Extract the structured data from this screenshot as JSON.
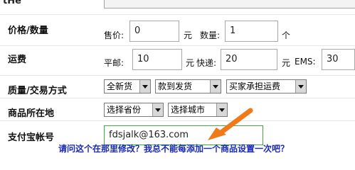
{
  "rows": {
    "cut_top_label": "tHe",
    "price_qty": {
      "label": "价格/数量",
      "price_prefix": "售价:",
      "price_value": "0",
      "price_unit": "元",
      "qty_prefix": "数量:",
      "qty_value": "1",
      "qty_unit": "个"
    },
    "shipping": {
      "label": "运费",
      "post_prefix": "平邮:",
      "post_value": "10",
      "post_unit": "元",
      "express_prefix": "快递:",
      "express_value": "20",
      "express_unit": "元",
      "ems_prefix": "EMS:",
      "ems_value": "30"
    },
    "quality_trade": {
      "label": "质量/交易方式",
      "quality_selected": "全新货",
      "delivery_selected": "款到发货",
      "shipping_payer_selected": "买家承担运费"
    },
    "location": {
      "label": "商品所在地",
      "province_selected": "选择省份",
      "city_selected": "选择城市"
    },
    "alipay": {
      "label": "支付宝帐号",
      "value": "fdsjalk@163.com"
    }
  },
  "annotation": {
    "question": "请问这个在那里修改？我总不能每添加一个商品设置一次吧？",
    "arrow_color": "#f07a1a"
  }
}
